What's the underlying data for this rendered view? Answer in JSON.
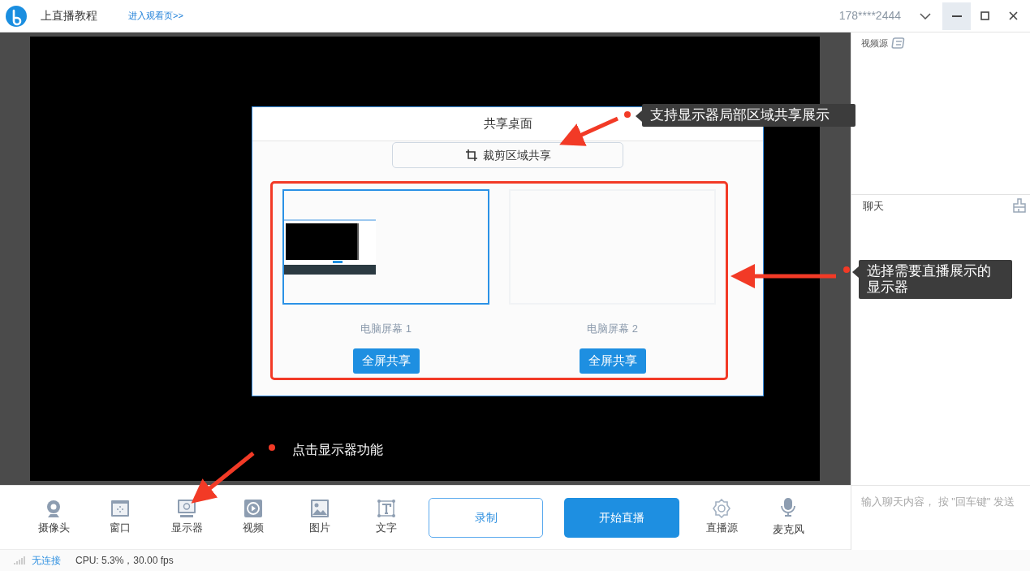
{
  "header": {
    "title": "上直播教程",
    "link": "进入观看页>>",
    "account": "178****2444"
  },
  "dialog": {
    "title": "共享桌面",
    "crop_button": "裁剪区域共享",
    "screens": [
      {
        "label": "电脑屏幕 1",
        "button": "全屏共享",
        "selected": true,
        "thumbnail": true
      },
      {
        "label": "电脑屏幕 2",
        "button": "全屏共享",
        "selected": false,
        "thumbnail": false
      }
    ]
  },
  "annotations": [
    {
      "text": "支持显示器局部区域共享展示",
      "kind": "callout"
    },
    {
      "text": "选择需要直播展示的显示器",
      "kind": "callout"
    },
    {
      "text": "点击显示器功能",
      "kind": "plain"
    }
  ],
  "toolbar": {
    "tools": [
      {
        "label": "摄像头",
        "kind": "camera"
      },
      {
        "label": "窗口",
        "kind": "window"
      },
      {
        "label": "显示器",
        "kind": "monitor"
      },
      {
        "label": "视频",
        "kind": "video"
      },
      {
        "label": "图片",
        "kind": "image"
      },
      {
        "label": "文字",
        "kind": "text"
      }
    ],
    "record_button": "录制",
    "start_button": "开始直播",
    "extras": [
      {
        "label": "直播源",
        "kind": "gear"
      },
      {
        "label": "麦克风",
        "kind": "mic"
      }
    ]
  },
  "sidebar": {
    "video_source": "视频源",
    "chat": "聊天",
    "chat_input": {
      "placeholder": "输入聊天内容， 按 \"回车键\" 发送"
    }
  },
  "status_bar": {
    "connection": "无连接",
    "stats": "CPU: 5.3%，30.00 fps"
  }
}
